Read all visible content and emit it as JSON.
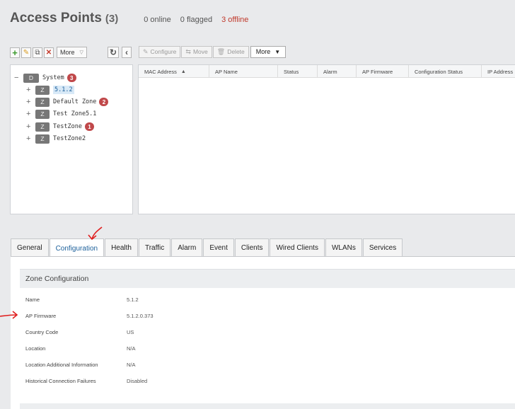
{
  "header": {
    "title": "Access Points",
    "count": "(3)",
    "online": "0 online",
    "flagged": "0 flagged",
    "offline": "3 offline",
    "offline_color": "#c0392b"
  },
  "tree_toolbar": {
    "more_label": "More"
  },
  "grid_toolbar": {
    "configure": "Configure",
    "move": "Move",
    "delete": "Delete",
    "more": "More"
  },
  "tree": [
    {
      "type": "D",
      "label": "System",
      "badge": "3"
    },
    {
      "type": "Z",
      "label": "5.1.2",
      "badge": ""
    },
    {
      "type": "Z",
      "label": "Default Zone",
      "badge": "2"
    },
    {
      "type": "Z",
      "label": "Test Zone5.1",
      "badge": ""
    },
    {
      "type": "Z",
      "label": "TestZone",
      "badge": "1"
    },
    {
      "type": "Z",
      "label": "TestZone2",
      "badge": ""
    }
  ],
  "grid": {
    "columns": [
      "MAC Address",
      "AP Name",
      "Status",
      "Alarm",
      "AP Firmware",
      "Configuration Status",
      "IP Address"
    ]
  },
  "tabs": [
    "General",
    "Configuration",
    "Health",
    "Traffic",
    "Alarm",
    "Event",
    "Clients",
    "Wired Clients",
    "WLANs",
    "Services"
  ],
  "zone_config": {
    "title": "Zone Configuration",
    "fields": [
      {
        "label": "Name",
        "value": "5.1.2"
      },
      {
        "label": "AP Firmware",
        "value": "5.1.2.0.373"
      },
      {
        "label": "Country Code",
        "value": "US"
      },
      {
        "label": "Location",
        "value": "N/A"
      },
      {
        "label": "Location Additional Information",
        "value": "N/A"
      },
      {
        "label": "Historical Connection Failures",
        "value": "Disabled"
      }
    ]
  },
  "annotation_color": "#e01e1e"
}
